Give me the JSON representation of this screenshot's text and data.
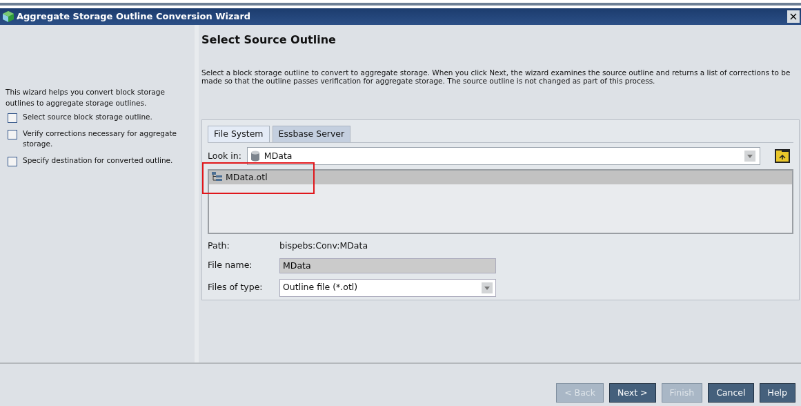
{
  "window": {
    "title": "Aggregate Storage Outline Conversion Wizard",
    "close": "×"
  },
  "sidebar": {
    "intro": "This wizard helps you convert block storage outlines to aggregate storage outlines.",
    "steps": [
      {
        "label": "Select source block storage outline.",
        "checked": false
      },
      {
        "label": "Verify corrections necessary for aggregate storage.",
        "checked": false
      },
      {
        "label": "Specify destination for converted outline.",
        "checked": false
      }
    ]
  },
  "page": {
    "heading": "Select Source Outline",
    "description": "Select a block storage outline to convert to aggregate storage. When you click Next, the wizard examines the source outline and returns a list of corrections to be made so that the outline passes verification for aggregate storage. The source outline is not changed as part of this process."
  },
  "tabs": [
    {
      "label": "File System",
      "selected": true
    },
    {
      "label": "Essbase Server",
      "selected": false
    }
  ],
  "look_in": {
    "label": "Look in:",
    "value": "MData"
  },
  "files": [
    {
      "name": "MData.otl",
      "selected": true
    }
  ],
  "path": {
    "label": "Path:",
    "value": "bispebs:Conv:MData"
  },
  "file_name": {
    "label": "File name:",
    "value": "MData"
  },
  "files_of_type": {
    "label": "Files of type:",
    "value": "Outline file (*.otl)"
  },
  "buttons": [
    {
      "label": "< Back",
      "disabled": true
    },
    {
      "label": "Next >",
      "disabled": false
    },
    {
      "label": "Finish",
      "disabled": true
    },
    {
      "label": "Cancel",
      "disabled": false
    },
    {
      "label": "Help",
      "disabled": false
    }
  ]
}
